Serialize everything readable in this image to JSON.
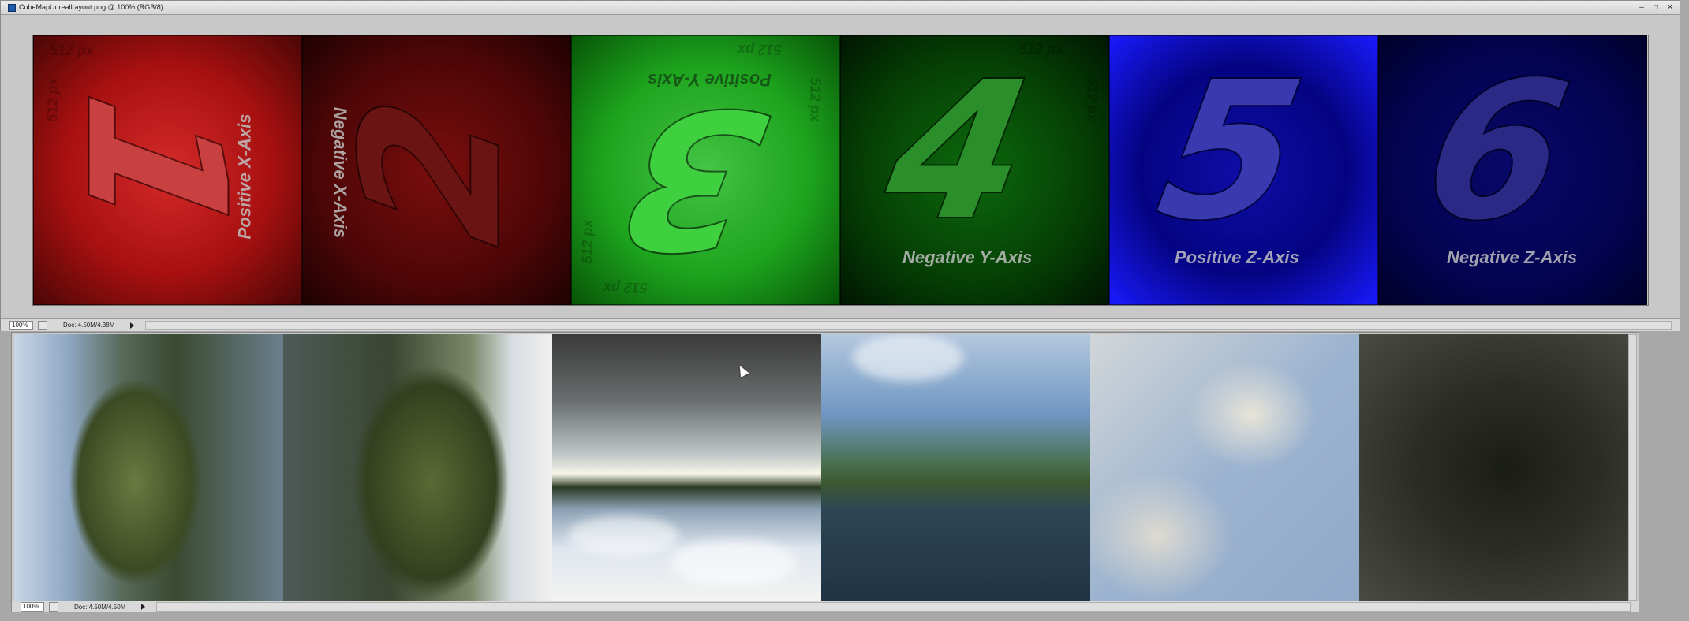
{
  "top_window": {
    "title": "CubeMapUnrealLayout.png @ 100% (RGB/8)",
    "controls": {
      "minimize": "–",
      "restore": "□",
      "close": "✕"
    },
    "zoom": "100%",
    "doc_info": "Doc: 4.50M/4.38M",
    "tiles": [
      {
        "number": "1",
        "axis_label": "Positive X-Axis",
        "color": "#c41c1c"
      },
      {
        "number": "2",
        "axis_label": "Negative X-Axis",
        "color": "#5a0808"
      },
      {
        "number": "3",
        "axis_label": "Positive Y-Axis",
        "color": "#22b022",
        "size_labels": [
          "512 px",
          "512 px",
          "512 px",
          "512 px"
        ]
      },
      {
        "number": "4",
        "axis_label": "Negative Y-Axis",
        "color": "#054805",
        "size_labels": [
          "512 px",
          "512 px"
        ]
      },
      {
        "number": "5",
        "axis_label": "Positive Z-Axis",
        "color": "#0a0a9a"
      },
      {
        "number": "6",
        "axis_label": "Negative Z-Axis",
        "color": "#05055e"
      }
    ],
    "tile1_size_labels": [
      "512 px",
      "512 px"
    ]
  },
  "bottom_window": {
    "zoom": "100%",
    "doc_info": "Doc: 4.50M/4.50M",
    "photos": [
      {
        "subject": "mountain-lake-rotated"
      },
      {
        "subject": "mountain-lake-rotated-mirror"
      },
      {
        "subject": "sky-and-water-upside-down"
      },
      {
        "subject": "mountain-lake-view"
      },
      {
        "subject": "cloudy-sky"
      },
      {
        "subject": "dark-water"
      }
    ]
  }
}
